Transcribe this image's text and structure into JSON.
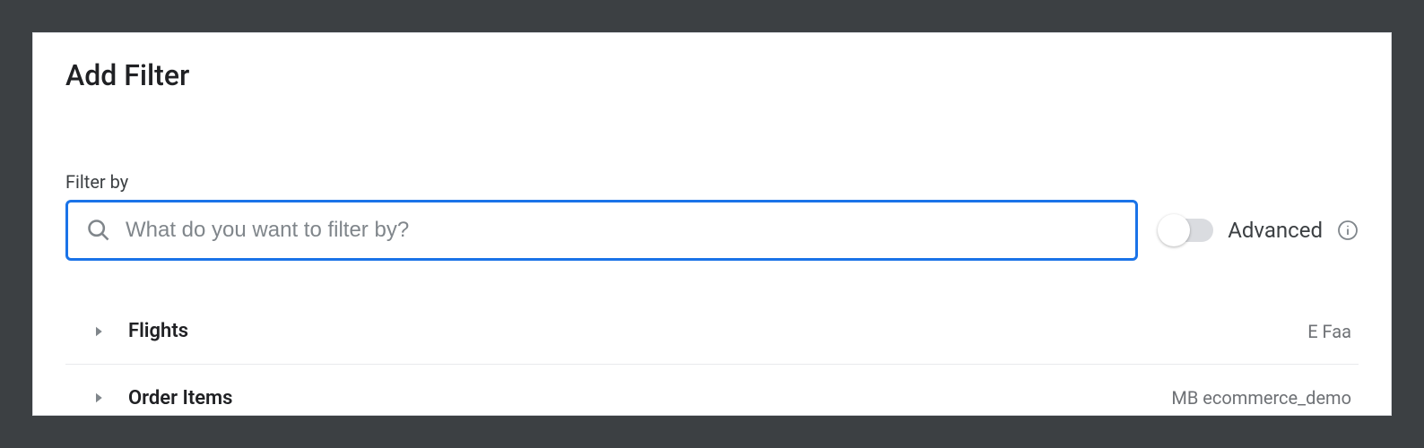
{
  "dialog": {
    "title": "Add Filter"
  },
  "filter": {
    "label": "Filter by",
    "placeholder": "What do you want to filter by?",
    "value": ""
  },
  "advanced": {
    "label": "Advanced",
    "enabled": false
  },
  "rows": [
    {
      "label": "Flights",
      "meta": "E Faa"
    },
    {
      "label": "Order Items",
      "meta": "MB ecommerce_demo"
    }
  ]
}
